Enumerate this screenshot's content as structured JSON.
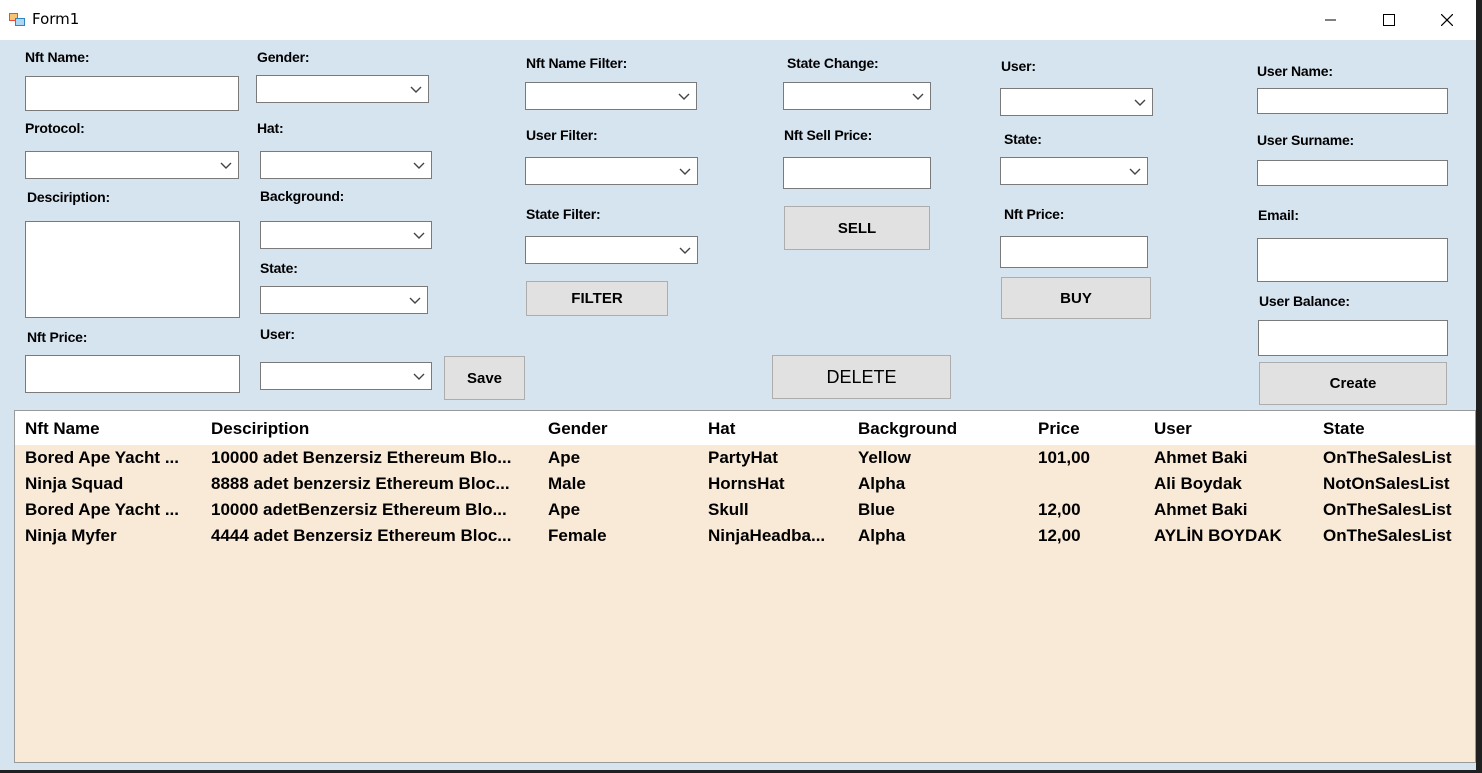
{
  "window": {
    "title": "Form1"
  },
  "nft_form": {
    "name_label": "Nft Name:",
    "name_value": "",
    "protocol_label": "Protocol:",
    "protocol_value": "",
    "description_label": "Desciription:",
    "description_value": "",
    "price_label": "Nft Price:",
    "price_value": "",
    "gender_label": "Gender:",
    "gender_value": "",
    "hat_label": "Hat:",
    "hat_value": "",
    "background_label": "Background:",
    "background_value": "",
    "state_label": "State:",
    "state_value": "",
    "user_label": "User:",
    "user_value": "",
    "save_label": "Save"
  },
  "filters": {
    "name_filter_label": "Nft Name Filter:",
    "user_filter_label": "User Filter:",
    "state_filter_label": "State Filter:",
    "filter_button": "FILTER"
  },
  "sell": {
    "state_change_label": "State Change:",
    "sell_price_label": "Nft Sell Price:",
    "sell_button": "SELL",
    "delete_button": "DELETE"
  },
  "buy": {
    "user_label": "User:",
    "state_label": "State:",
    "price_label": "Nft Price:",
    "buy_button": "BUY"
  },
  "user_form": {
    "name_label": "User Name:",
    "surname_label": "User Surname:",
    "email_label": "Email:",
    "balance_label": "User Balance:",
    "create_button": "Create"
  },
  "grid": {
    "columns": [
      "Nft Name",
      "Desciription",
      "Gender",
      "Hat",
      "Background",
      "Price",
      "User",
      "State"
    ],
    "rows": [
      [
        "Bored Ape Yacht ...",
        "10000 adet Benzersiz Ethereum Blo...",
        "Ape",
        "PartyHat",
        "Yellow",
        "101,00",
        "Ahmet Baki",
        "OnTheSalesList"
      ],
      [
        "Ninja Squad",
        "8888 adet benzersiz Ethereum Bloc...",
        "Male",
        "HornsHat",
        "Alpha",
        "",
        "Ali Boydak",
        "NotOnSalesList"
      ],
      [
        "Bored Ape Yacht ...",
        "10000 adetBenzersiz Ethereum Blo...",
        "Ape",
        "Skull",
        "Blue",
        "12,00",
        "Ahmet Baki",
        "OnTheSalesList"
      ],
      [
        "Ninja Myfer",
        "4444 adet Benzersiz Ethereum Bloc...",
        "Female",
        "NinjaHeadba...",
        "Alpha",
        "12,00",
        "AYLİN BOYDAK",
        "OnTheSalesList"
      ]
    ]
  }
}
